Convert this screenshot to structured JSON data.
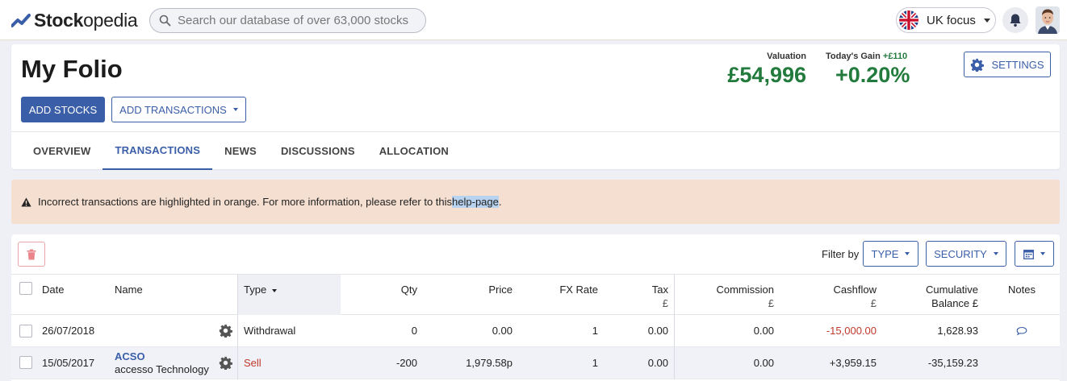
{
  "brand": {
    "name_bold": "Stock",
    "name_rest": "opedia"
  },
  "search": {
    "placeholder": "Search our database of over 63,000 stocks"
  },
  "focus": {
    "label": "UK focus"
  },
  "folio": {
    "title": "My Folio",
    "add_stocks": "ADD STOCKS",
    "add_transactions": "ADD TRANSACTIONS",
    "valuation_label": "Valuation",
    "valuation": "£54,996",
    "gain_label": "Today's Gain",
    "gain_abs": "+£110",
    "gain_pct": "+0.20%",
    "settings": "SETTINGS"
  },
  "tabs": [
    {
      "label": "OVERVIEW"
    },
    {
      "label": "TRANSACTIONS"
    },
    {
      "label": "NEWS"
    },
    {
      "label": "DISCUSSIONS"
    },
    {
      "label": "ALLOCATION"
    }
  ],
  "alert": {
    "text": "Incorrect transactions are highlighted in orange. For more information, please refer to this ",
    "link": "help-page",
    "end": "."
  },
  "filters": {
    "label": "Filter by",
    "type": "TYPE",
    "security": "SECURITY"
  },
  "columns": {
    "date": "Date",
    "name": "Name",
    "type": "Type",
    "qty": "Qty",
    "price": "Price",
    "fx": "FX Rate",
    "tax": "Tax",
    "tax_unit": "£",
    "commission": "Commission",
    "commission_unit": "£",
    "cashflow": "Cashflow",
    "cashflow_unit": "£",
    "cumulative": "Cumulative",
    "balance": "Balance £",
    "notes": "Notes"
  },
  "rows": [
    {
      "date": "26/07/2018",
      "ticker": "",
      "company": "",
      "type": "Withdrawal",
      "qty": "0",
      "price": "0.00",
      "fx": "1",
      "tax": "0.00",
      "commission": "0.00",
      "cashflow": "-15,000.00",
      "balance": "1,628.93"
    },
    {
      "date": "15/05/2017",
      "ticker": "ACSO",
      "company": "accesso Technology",
      "type": "Sell",
      "qty": "-200",
      "price": "1,979.58p",
      "fx": "1",
      "tax": "0.00",
      "commission": "0.00",
      "cashflow": "+3,959.15",
      "balance": "-35,159.23"
    }
  ],
  "colors": {
    "accent": "#3a5ea8",
    "positive": "#227a3d",
    "negative": "#c0392b",
    "alert_bg": "#f5dfd0"
  }
}
